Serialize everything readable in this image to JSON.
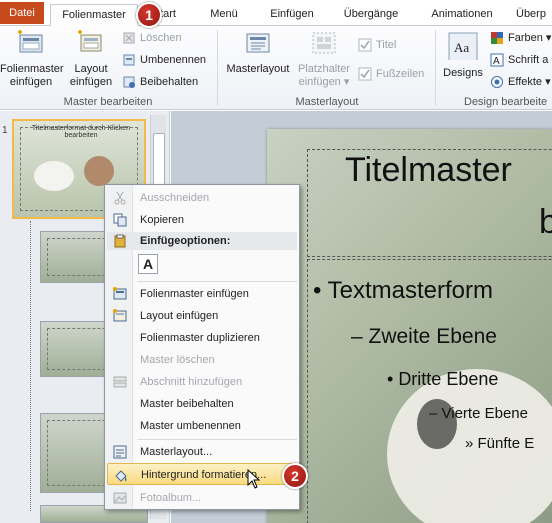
{
  "tabs": {
    "file": "Datei",
    "active": "Folienmaster",
    "start_partial": "tart",
    "items": [
      "Menü",
      "Einfügen",
      "Übergänge",
      "Animationen",
      "Überp"
    ]
  },
  "ribbon": {
    "master_bearbeiten": {
      "label": "Master bearbeiten",
      "insert_master": "Folienmaster\neinfügen",
      "insert_layout": "Layout\neinfügen",
      "delete": "Löschen",
      "rename": "Umbenennen",
      "keep": "Beibehalten"
    },
    "masterlayout": {
      "label": "Masterlayout",
      "masterlayout_btn": "Masterlayout",
      "placeholder_btn": "Platzhalter\neinfügen ▾",
      "title_check": "Titel",
      "footer_check": "Fußzeilen"
    },
    "design": {
      "label": "Design bearbeite",
      "designs_btn": "Designs",
      "colors": "Farben ▾",
      "fonts": "Schrift a",
      "effects": "Effekte ▾"
    }
  },
  "thumbnails": {
    "slide_number": "1",
    "master_title_text": "Titelmasterformat durch Klicken bearbeiten"
  },
  "slide": {
    "title_line1": "Titelmaster",
    "title_line2": "b",
    "level1": "Textmasterform",
    "level2": "– Zweite Ebene",
    "level3": "Dritte Ebene",
    "level4": "– Vierte Ebene",
    "level5": "» Fünfte E"
  },
  "context_menu": {
    "cut": "Ausschneiden",
    "copy": "Kopieren",
    "paste_options_header": "Einfügeoptionen:",
    "paste_option_glyph": "A",
    "insert_master": "Folienmaster einfügen",
    "insert_layout": "Layout einfügen",
    "duplicate_master": "Folienmaster duplizieren",
    "delete_master": "Master löschen",
    "add_section": "Abschnitt hinzufügen",
    "keep_master": "Master beibehalten",
    "rename_master": "Master umbenennen",
    "master_layout": "Masterlayout...",
    "format_background": "Hintergrund formatieren...",
    "photo_album": "Fotoalbum..."
  },
  "callouts": {
    "one": "1",
    "two": "2"
  }
}
